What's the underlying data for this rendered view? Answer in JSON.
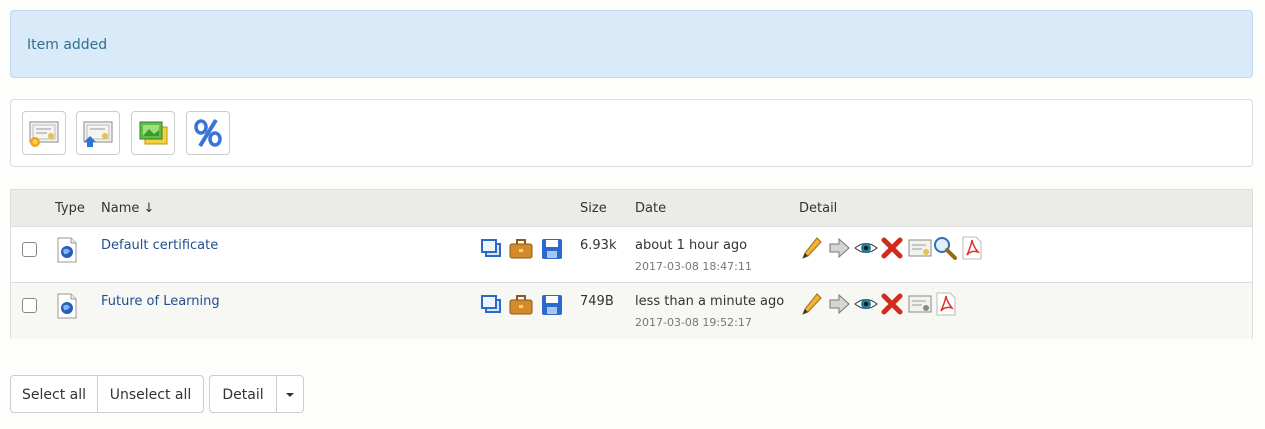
{
  "alert": {
    "message": "Item added"
  },
  "toolbar": {
    "buttons": [
      {
        "icon": "new-certificate-icon"
      },
      {
        "icon": "upload-certificate-icon"
      },
      {
        "icon": "images-icon"
      },
      {
        "icon": "percent-icon"
      }
    ]
  },
  "table": {
    "headers": {
      "type": "Type",
      "name": "Name ↓",
      "size": "Size",
      "date": "Date",
      "detail": "Detail"
    },
    "rows": [
      {
        "name": "Default certificate",
        "size": "6.93k",
        "date_relative": "about 1 hour ago",
        "date_full": "2017-03-08 18:47:11",
        "detail_icons": [
          "edit-icon",
          "move-icon",
          "view-icon",
          "delete-icon",
          "certificate-icon",
          "search-icon",
          "pdf-icon"
        ]
      },
      {
        "name": "Future of Learning",
        "size": "749B",
        "date_relative": "less than a minute ago",
        "date_full": "2017-03-08 19:52:17",
        "detail_icons": [
          "edit-icon",
          "move-icon",
          "view-icon",
          "delete-icon",
          "certificate-icon",
          "pdf-icon"
        ]
      }
    ]
  },
  "actions": {
    "select_all": "Select all",
    "unselect_all": "Unselect all",
    "detail": "Detail"
  }
}
